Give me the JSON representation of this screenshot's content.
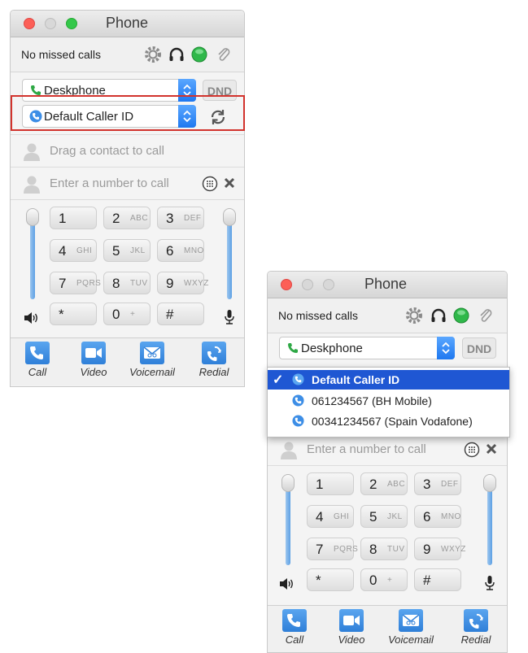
{
  "window_left": {
    "title": "Phone",
    "status": "No missed calls",
    "device_select": "Deskphone",
    "dnd_label": "DND",
    "caller_id_select": "Default Caller ID",
    "drag_placeholder": "Drag a contact to call",
    "number_placeholder": "Enter a number to call"
  },
  "window_right": {
    "title": "Phone",
    "status": "No missed calls",
    "device_select": "Deskphone",
    "dnd_label": "DND",
    "number_placeholder": "Enter a number to call"
  },
  "dropdown": {
    "options": [
      {
        "label": "Default Caller ID",
        "selected": true,
        "check": "✓"
      },
      {
        "label": "061234567 (BH Mobile)",
        "selected": false
      },
      {
        "label": "00341234567 (Spain Vodafone)",
        "selected": false
      }
    ]
  },
  "keypad": [
    {
      "digit": "1",
      "letters": ""
    },
    {
      "digit": "2",
      "letters": "ABC"
    },
    {
      "digit": "3",
      "letters": "DEF"
    },
    {
      "digit": "4",
      "letters": "GHI"
    },
    {
      "digit": "5",
      "letters": "JKL"
    },
    {
      "digit": "6",
      "letters": "MNO"
    },
    {
      "digit": "7",
      "letters": "PQRS"
    },
    {
      "digit": "8",
      "letters": "TUV"
    },
    {
      "digit": "9",
      "letters": "WXYZ"
    },
    {
      "digit": "*",
      "letters": ""
    },
    {
      "digit": "0",
      "letters": "+"
    },
    {
      "digit": "#",
      "letters": ""
    }
  ],
  "actions": [
    "Call",
    "Video",
    "Voicemail",
    "Redial"
  ],
  "colors": {
    "accent": "#1f57d3",
    "highlight_box": "#d2332d",
    "button_blue": "#2f7fd8",
    "status_green": "#2fb84a"
  },
  "icons": {
    "status": [
      "gear-icon",
      "headset-icon",
      "presence-green-icon",
      "paperclip-icon"
    ],
    "device": "phone-handset-icon",
    "caller_id": "caller-id-icon",
    "refresh": "refresh-icon",
    "dialpad": "dialpad-icon",
    "clear": "clear-x-icon",
    "speaker": "speaker-icon",
    "mic": "microphone-icon"
  }
}
